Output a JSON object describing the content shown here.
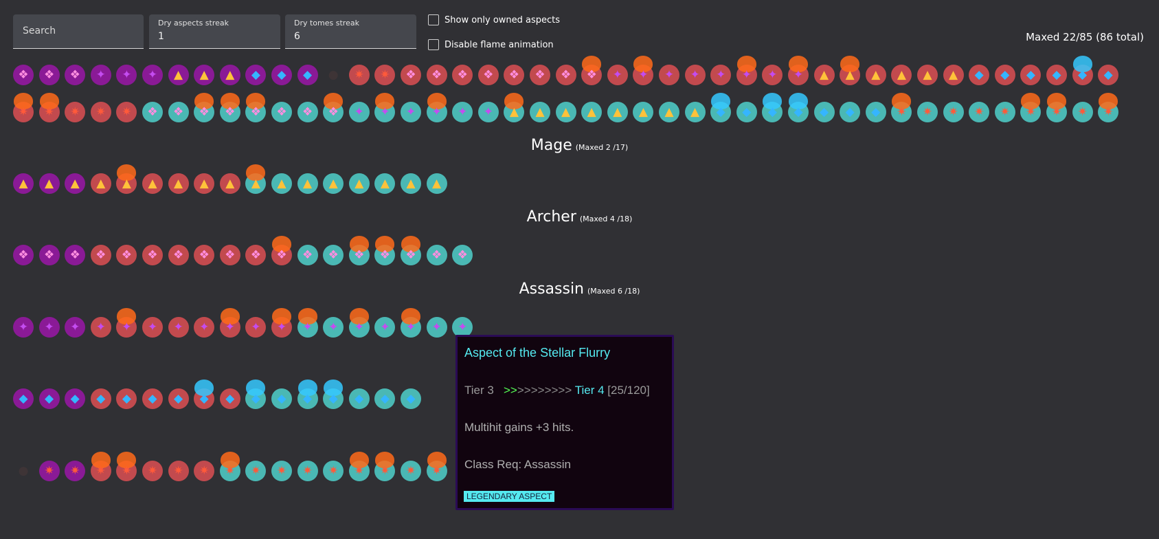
{
  "controls": {
    "search_placeholder": "Search",
    "dry_aspects_label": "Dry aspects streak",
    "dry_aspects_value": "1",
    "dry_tomes_label": "Dry tomes streak",
    "dry_tomes_value": "6",
    "show_owned_label": "Show only owned aspects",
    "disable_flame_label": "Disable flame animation"
  },
  "summary": {
    "maxed_text": "Maxed 22/85 (86 total)"
  },
  "colors": {
    "background": "#303034",
    "tier_bg": {
      "purple": "#8a1a96",
      "red": "#c24a4e",
      "teal": "#4ab8b4"
    },
    "glyph": {
      "crystal": "#ff8ee0",
      "horn": "#c44cf0",
      "flame": "#ffc23a",
      "drop": "#35b5ff",
      "beast": "#ff5a3a",
      "ghost": "#5a3c3c"
    },
    "flame_maxed": {
      "orange": "#ff6a1a",
      "cyan": "#35c8ff"
    }
  },
  "sections": [
    {
      "key": "all",
      "title": "",
      "subtitle": ""
    },
    {
      "key": "mage",
      "title": "Mage",
      "subtitle": "(Maxed 2 /17)"
    },
    {
      "key": "archer",
      "title": "Archer",
      "subtitle": "(Maxed 4 /18)"
    },
    {
      "key": "assassin",
      "title": "Assassin",
      "subtitle": "(Maxed 6 /18)"
    }
  ],
  "tooltip": {
    "name": "Aspect of the Stellar Flurry",
    "tier_from": "Tier 3",
    "arrows_done": ">>",
    "arrows_left": ">>>>>>>>",
    "tier_to": "Tier 4",
    "progress": "[25/120]",
    "effect": "Multihit gains +3 hits.",
    "class_req": "Class Req: Assassin",
    "rarity_badge": "LEGENDARY ASPECT"
  },
  "icon_rows": [
    {
      "name": "all-row-1",
      "icons": "C1 C1 C1 H1 H1 H1 F1 F1 F1 D1 D1 D1 X0 B2 B2 C2 C2 C2 C2 C2 C2 C2 C2M H2 H2M H2 H2 H2 H2M H2 H2M F2 F2M F2 F2 F2 F2 D2 D2 D2 D2 D2M D2"
    },
    {
      "name": "all-row-2",
      "icons": "B2M B2M B2 B2 B2 C3 C3 C3M C3M C3M C3 C3 C3M H3 H3M H3 H3M H3 H3 F3M F3 F3 F3 F3 F3 F3 F3 D3M D3 D3M D3M D3 D3 D3 B3M B3 B3 B3 B3 B3M B3M B3 B3M"
    },
    {
      "name": "mage-row",
      "icons": "F1 F1 F1 F2 F2M F2 F2 F2 F2 F3M F3 F3 F3 F3 F3 F3 F3"
    },
    {
      "name": "archer-row",
      "icons": "C1 C1 C1 C2 C2 C2 C2 C2 C2 C2 C2M C3 C3 C3M C3M C3M C3 C3"
    },
    {
      "name": "assassin-row",
      "icons": "H1 H1 H1 H2 H2M H2 H2 H2 H2M H2 H2M H3M H3 H3M H3 H3M H3 H3"
    },
    {
      "name": "unlabeled-row-1",
      "icons": "D1 D1 D1 D2 D2 D2 D2 D2M D2 D3M D3 D3M D3M D3 D3 D3"
    },
    {
      "name": "unlabeled-row-2",
      "icons": "X0 B1 B1 B2M B2M B2 B2 B2 B3M B3 B3 B3 B3 B3M B3M B3 B3M"
    }
  ]
}
